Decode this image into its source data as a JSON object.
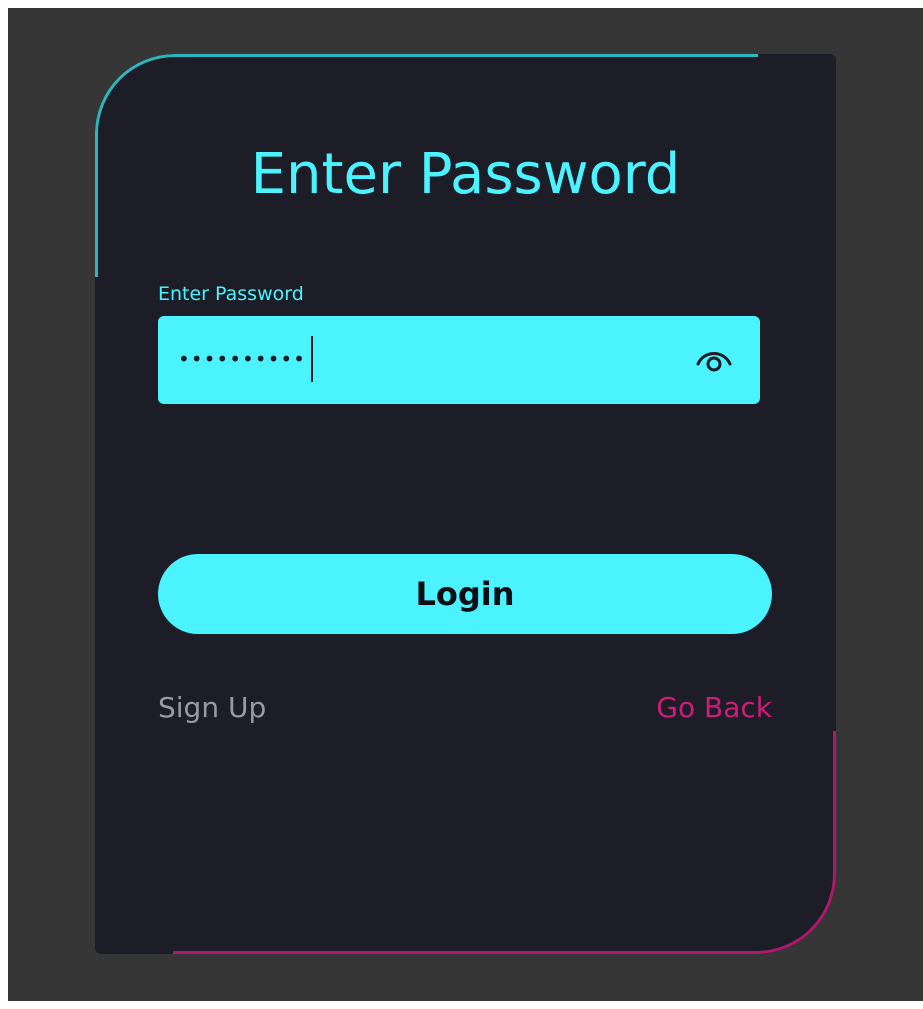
{
  "title": "Enter Password",
  "password_field": {
    "label": "Enter Password",
    "masked_value": "••••••••••"
  },
  "icons": {
    "visibility_toggle": "eye-icon"
  },
  "login_button": {
    "label": "Login"
  },
  "links": {
    "sign_up": "Sign Up",
    "go_back": "Go Back"
  },
  "colors": {
    "accent_cyan": "#4af3ff",
    "accent_pink": "#d01a7c",
    "card_background": "#1c1d26",
    "page_background": "#363636",
    "muted_text": "#9a9aa3"
  }
}
